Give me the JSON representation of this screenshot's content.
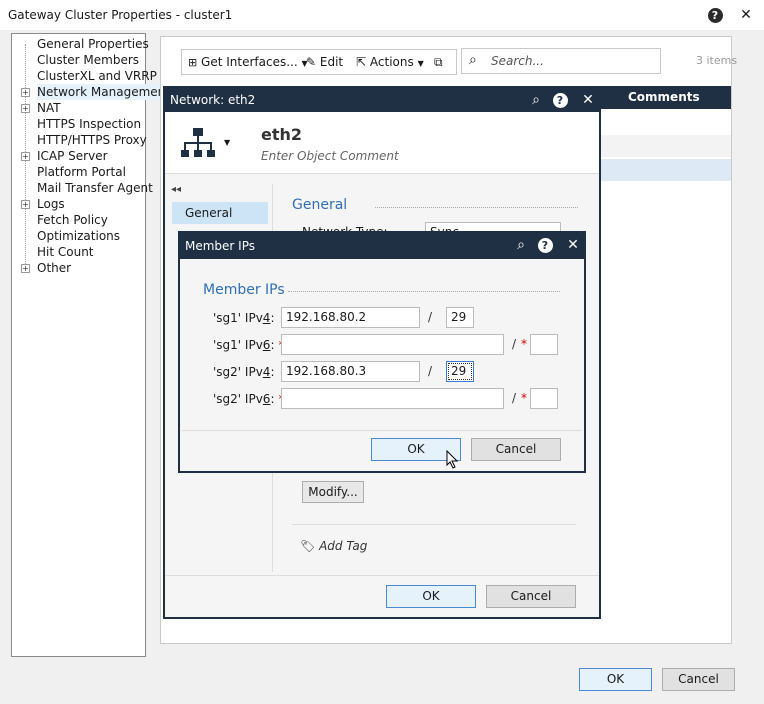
{
  "window": {
    "title": "Gateway Cluster Properties - cluster1",
    "help_icon": "help-icon",
    "close_icon": "close-icon"
  },
  "tree": {
    "items": [
      {
        "label": "General Properties",
        "expandable": false
      },
      {
        "label": "Cluster Members",
        "expandable": false
      },
      {
        "label": "ClusterXL and VRRP",
        "expandable": false
      },
      {
        "label": "Network Management",
        "expandable": true,
        "selected": true
      },
      {
        "label": "NAT",
        "expandable": true
      },
      {
        "label": "HTTPS Inspection",
        "expandable": false
      },
      {
        "label": "HTTP/HTTPS Proxy",
        "expandable": false
      },
      {
        "label": "ICAP Server",
        "expandable": true
      },
      {
        "label": "Platform Portal",
        "expandable": false
      },
      {
        "label": "Mail Transfer Agent",
        "expandable": false
      },
      {
        "label": "Logs",
        "expandable": true
      },
      {
        "label": "Fetch Policy",
        "expandable": false
      },
      {
        "label": "Optimizations",
        "expandable": false
      },
      {
        "label": "Hit Count",
        "expandable": false
      },
      {
        "label": "Other",
        "expandable": true
      }
    ]
  },
  "toolbar": {
    "get_interfaces": "Get Interfaces...",
    "edit": "Edit",
    "actions": "Actions",
    "search_placeholder": "Search...",
    "items_count": "3 items",
    "column_comments": "Comments"
  },
  "network_dialog": {
    "title": "Network: eth2",
    "name": "eth2",
    "comment_placeholder": "Enter Object Comment",
    "nav_general": "General",
    "section_general": "General",
    "network_type_label": "Network Type:",
    "network_type_value": "Sync",
    "modify_label": "Modify...",
    "add_tag": "Add Tag",
    "ok": "OK",
    "cancel": "Cancel"
  },
  "member_dialog": {
    "title": "Member IPs",
    "section": "Member IPs",
    "rows": [
      {
        "label_pre": "'sg1' IPv",
        "label_u": "4",
        "label_post": ":",
        "required": false,
        "ip": "192.168.80.2",
        "mask": "29"
      },
      {
        "label_pre": "'sg1' IPv",
        "label_u": "6",
        "label_post": ":",
        "required": true,
        "ip": "",
        "mask": ""
      },
      {
        "label_pre": "'sg2' IPv",
        "label_u": "4",
        "label_post": ":",
        "required": false,
        "ip": "192.168.80.3",
        "mask": "29"
      },
      {
        "label_pre": "'sg2' IPv",
        "label_u": "6",
        "label_post": ":",
        "required": true,
        "ip": "",
        "mask": ""
      }
    ],
    "slash": "/",
    "required_mark": "*",
    "ok": "OK",
    "cancel": "Cancel"
  },
  "footer": {
    "ok": "OK",
    "cancel": "Cancel"
  }
}
